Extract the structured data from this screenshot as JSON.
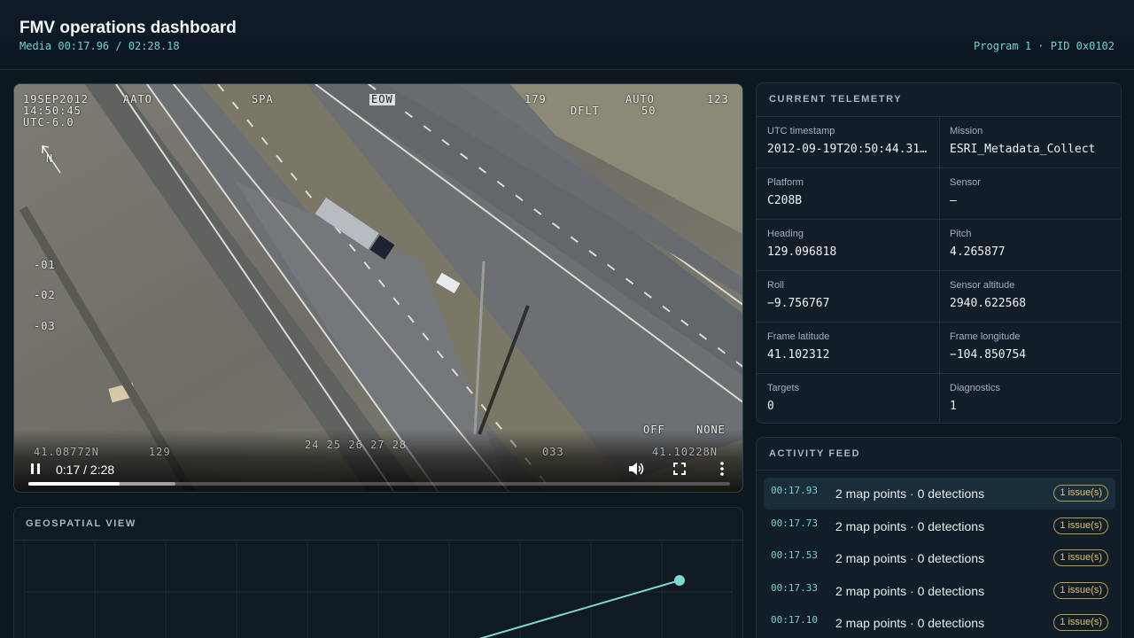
{
  "header": {
    "title": "FMV operations dashboard",
    "media_time": "Media 00:17.96 / 02:28.18",
    "program_info": "Program 1 · PID 0x0102"
  },
  "video": {
    "osd": {
      "date": "19SEP2012",
      "time": "14:50:45",
      "utc": "UTC-6.0",
      "aato": "AATO",
      "spa": "SPA",
      "eow": "EOW",
      "heading_num": "179",
      "auto": "AUTO",
      "dflt": "DFLT",
      "fifty": "50",
      "right_num": "123",
      "north": "N",
      "lad1": "-01",
      "lad2": "-02",
      "lad3": "-03",
      "off": "OFF",
      "none": "NONE",
      "lat": "41.08772N",
      "ret_129": "129",
      "scale": "24  25  26  27  28",
      "b033": "033",
      "lon": "41.10228N"
    },
    "controls": {
      "time": "0:17 / 2:28",
      "played_fraction": 0.13,
      "buffered_fraction": 0.21,
      "icons": [
        "pause-icon",
        "volume-icon",
        "fullscreen-icon",
        "more-icon"
      ]
    }
  },
  "geo": {
    "title": "GEOSPATIAL VIEW"
  },
  "telemetry": {
    "title": "CURRENT TELEMETRY",
    "fields": [
      {
        "label": "UTC timestamp",
        "value": "2012-09-19T20:50:44.31..."
      },
      {
        "label": "Mission",
        "value": "ESRI_Metadata_Collect"
      },
      {
        "label": "Platform",
        "value": "C208B"
      },
      {
        "label": "Sensor",
        "value": "—"
      },
      {
        "label": "Heading",
        "value": "129.096818"
      },
      {
        "label": "Pitch",
        "value": "4.265877"
      },
      {
        "label": "Roll",
        "value": "−9.756767"
      },
      {
        "label": "Sensor altitude",
        "value": "2940.622568"
      },
      {
        "label": "Frame latitude",
        "value": "41.102312"
      },
      {
        "label": "Frame longitude",
        "value": "−104.850754"
      },
      {
        "label": "Targets",
        "value": "0"
      },
      {
        "label": "Diagnostics",
        "value": "1"
      }
    ]
  },
  "feed": {
    "title": "ACTIVITY FEED",
    "items": [
      {
        "time": "00:17.93",
        "text": "2 map points · 0 detections",
        "badge": "1 issue(s)"
      },
      {
        "time": "00:17.73",
        "text": "2 map points · 0 detections",
        "badge": "1 issue(s)"
      },
      {
        "time": "00:17.53",
        "text": "2 map points · 0 detections",
        "badge": "1 issue(s)"
      },
      {
        "time": "00:17.33",
        "text": "2 map points · 0 detections",
        "badge": "1 issue(s)"
      },
      {
        "time": "00:17.10",
        "text": "2 map points · 0 detections",
        "badge": "1 issue(s)"
      }
    ]
  },
  "colors": {
    "accent": "#6fd3d0",
    "badge": "#e0c06a",
    "background": "#0d1720"
  }
}
